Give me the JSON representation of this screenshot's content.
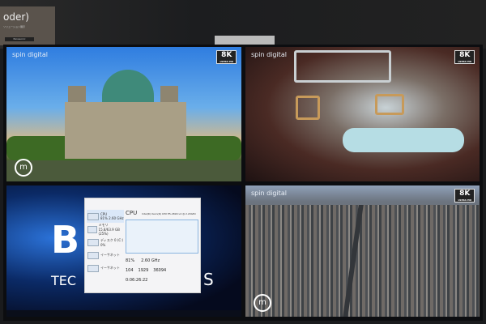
{
  "booth_sign": {
    "title": "oder)",
    "subtitle": "ソリューション展示",
    "button": "Panasonic"
  },
  "screens": [
    {
      "brand": "spin digital",
      "badge": "8K",
      "badge_sub": "ULTRA HD",
      "logo": "m"
    },
    {
      "brand": "spin digital",
      "badge": "8K",
      "badge_sub": "ULTRA HD"
    },
    {
      "background_text": [
        "B",
        "TEC",
        "S"
      ],
      "task_manager": {
        "sidebar": [
          {
            "label": "CPU",
            "detail": "81% 2.60 GHz"
          },
          {
            "label": "メモリ",
            "detail": "15.8/63.9 GB (25%)"
          },
          {
            "label": "ディスク 0 (C:)",
            "detail": "0%"
          },
          {
            "label": "イーサネット",
            "detail": ""
          },
          {
            "label": "イーサネット",
            "detail": ""
          }
        ],
        "heading": "CPU",
        "processor": "Intel(R) Xeon(R) CPU E5-2699 v4 @ 2.20GHz",
        "utilization": "81%",
        "speed": "2.60 GHz",
        "processes": "104",
        "threads": "1929",
        "handles": "36094",
        "uptime": "0:06:26:22"
      }
    },
    {
      "brand": "spin digital",
      "badge": "8K",
      "badge_sub": "ULTRA HD",
      "logo": "m"
    }
  ]
}
